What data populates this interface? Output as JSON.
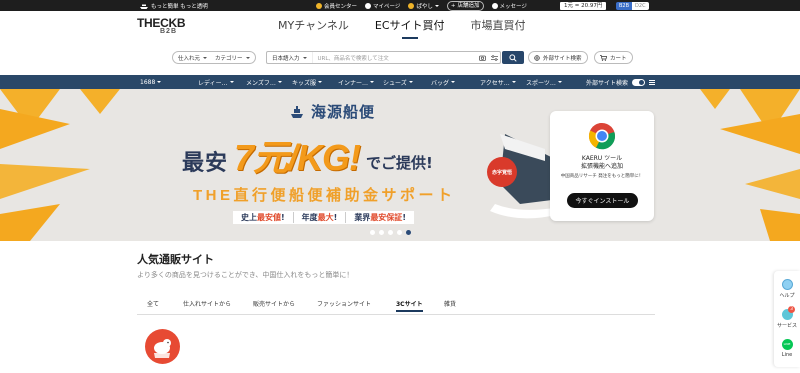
{
  "topbar": {
    "tagline": "もっと簡単 もっと透明",
    "nav": [
      "会員センター",
      "マイページ",
      "ぱやし",
      "店舗追加",
      "メッセージ"
    ],
    "rate": "1元 = 20.97円",
    "mode_active": "B2B",
    "mode_inactive": "D2C"
  },
  "header": {
    "logo_top": "THECKB",
    "logo_bottom": "B2B",
    "tabs": [
      "MYチャンネル",
      "ECサイト買付",
      "市場直買付"
    ],
    "active_tab": "ECサイト買付"
  },
  "search": {
    "filter1": "仕入れ元",
    "filter2": "カテゴリー",
    "scope": "日本語入力",
    "placeholder": "URL、商品名で検索して注文",
    "external_search": "外部サイト検索",
    "cart": "カート"
  },
  "catnav": {
    "items": [
      "1688",
      "レディー…",
      "メンズフ…",
      "キッズ服",
      "インナー…",
      "シューズ",
      "バッグ",
      "アクセサ…",
      "スポーツ…"
    ],
    "external_search": "外部サイト検索"
  },
  "banner": {
    "title": "海源船便",
    "lead": "最安",
    "price": "7元/KG!",
    "offer": "でご提供!",
    "badge": "赤字覚悟",
    "subtitle": "THE直行便船便補助金サポート",
    "tags": [
      {
        "pre": "史上",
        "em": "最安値",
        "post": "!"
      },
      {
        "pre": "年度",
        "em": "最大",
        "post": "!"
      },
      {
        "pre": "業界",
        "em": "最安保証",
        "post": "!"
      }
    ],
    "slides": 5,
    "active_slide": 5
  },
  "kaeru": {
    "line1": "KAERU ツール",
    "line2": "拡張機能へ追加",
    "desc": "中国商品リサーチ 発注をもっと簡単に！",
    "button": "今すぐインストール"
  },
  "popular": {
    "title": "人気通販サイト",
    "subtitle": "より多くの商品を見つけることができ、中国仕入れをもっと簡単に！",
    "tabs": [
      "全て",
      "仕入れサイトから",
      "販売サイトから",
      "ファッションサイト",
      "3Cサイト",
      "雑貨"
    ],
    "active_tab": "3Cサイト"
  },
  "float": {
    "help": "ヘルプ",
    "service": "サービス",
    "service_count": "3",
    "line": "Line",
    "line_icon_text": "LINE"
  },
  "colors": {
    "navy": "#2a4868",
    "orange": "#f39a1b",
    "dark": "#1e1e1e"
  }
}
